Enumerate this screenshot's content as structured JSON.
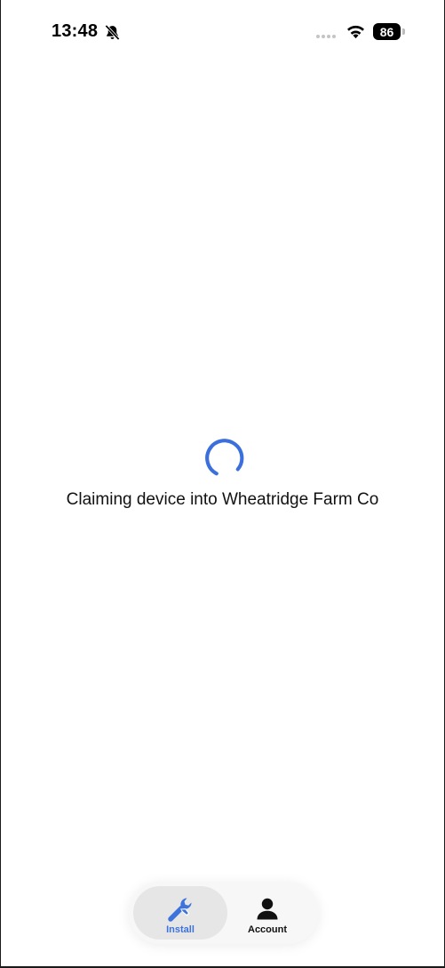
{
  "status_bar": {
    "time": "13:48",
    "battery": "86",
    "bell_icon": "bell-slash-icon",
    "wifi_icon": "wifi-icon"
  },
  "loading": {
    "message": "Claiming device into Wheatridge Farm Co",
    "spinner_color": "#3a6fdc"
  },
  "tab_bar": {
    "tabs": [
      {
        "label": "Install",
        "icon": "wrench-icon",
        "active": true
      },
      {
        "label": "Account",
        "icon": "person-icon",
        "active": false
      }
    ]
  },
  "colors": {
    "accent": "#3d73db",
    "background": "#ffffff"
  }
}
